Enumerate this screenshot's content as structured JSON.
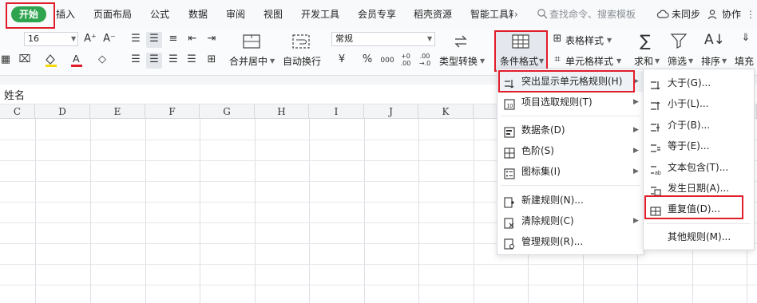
{
  "tabs": [
    "开始",
    "插入",
    "页面布局",
    "公式",
    "数据",
    "审阅",
    "视图",
    "开发工具",
    "会员专享",
    "稻壳资源",
    "智能工具箱"
  ],
  "tab_more": "›",
  "search_placeholder": "查找命令、搜索模板",
  "sync_label": "未同步",
  "collab_label": "协作",
  "ribbon": {
    "font_size": "16",
    "font_grow": "A⁺",
    "font_shrink": "A⁻",
    "merge_label": "合并居中",
    "wrap_label": "自动换行",
    "number_format": "常规",
    "currency": "¥",
    "percent": "%",
    "thousands": "000",
    "dec_inc": "+0 .00",
    "dec_dec": ".00 →.0",
    "convert_label": "类型转换",
    "cond_format_label": "条件格式",
    "table_style_label": "表格样式",
    "cell_style_label": "单元格样式",
    "sum_label": "求和",
    "filter_label": "筛选",
    "sort_label": "排序",
    "fill_label": "填充"
  },
  "name_box_text": "姓名",
  "columns": [
    "C",
    "D",
    "E",
    "F",
    "G",
    "H",
    "I",
    "J",
    "K"
  ],
  "menu1": [
    {
      "label": "突出显示单元格规则(H)",
      "icon": "highlight-rules-icon",
      "arrow": true
    },
    {
      "label": "项目选取规则(T)",
      "icon": "top-bottom-rules-icon",
      "arrow": true
    },
    {
      "label": "数据条(D)",
      "icon": "data-bars-icon",
      "arrow": true
    },
    {
      "label": "色阶(S)",
      "icon": "color-scales-icon",
      "arrow": true
    },
    {
      "label": "图标集(I)",
      "icon": "icon-sets-icon",
      "arrow": true
    },
    {
      "label": "新建规则(N)...",
      "icon": "new-rule-icon",
      "arrow": false
    },
    {
      "label": "清除规则(C)",
      "icon": "clear-rules-icon",
      "arrow": true
    },
    {
      "label": "管理规则(R)...",
      "icon": "manage-rules-icon",
      "arrow": false
    }
  ],
  "menu2": [
    {
      "label": "大于(G)...",
      "icon": "greater-than-icon"
    },
    {
      "label": "小于(L)...",
      "icon": "less-than-icon"
    },
    {
      "label": "介于(B)...",
      "icon": "between-icon"
    },
    {
      "label": "等于(E)...",
      "icon": "equal-to-icon"
    },
    {
      "label": "文本包含(T)...",
      "icon": "text-contains-icon"
    },
    {
      "label": "发生日期(A)...",
      "icon": "date-occurring-icon"
    },
    {
      "label": "重复值(D)...",
      "icon": "duplicate-values-icon"
    },
    {
      "label": "其他规则(M)...",
      "icon": ""
    }
  ],
  "colors": {
    "accent_green": "#2ea44f",
    "highlight_red": "#e11d2a",
    "font_color_red": "#e11d2a",
    "fill_yellow": "#f5d90a"
  }
}
